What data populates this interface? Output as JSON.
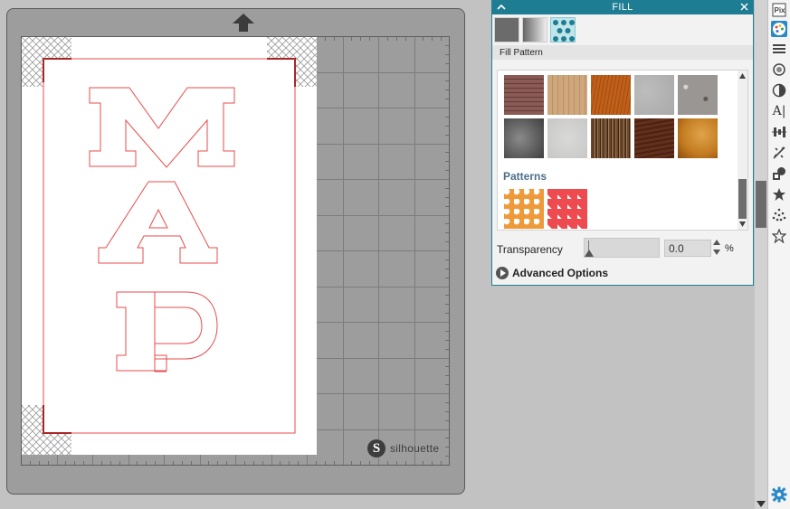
{
  "mat": {
    "brand": "silhouette"
  },
  "design": {
    "text": "MAP"
  },
  "fill_panel": {
    "title": "FILL",
    "fill_types": [
      {
        "name": "solid",
        "icon": "solid-fill-icon"
      },
      {
        "name": "gradient",
        "icon": "gradient-fill-icon"
      },
      {
        "name": "pattern",
        "icon": "pattern-fill-icon",
        "selected": true
      }
    ],
    "section_label": "Fill Pattern",
    "textures": [
      {
        "name": "brick",
        "color": "#8a5a55"
      },
      {
        "name": "light-wood",
        "color": "#cfa77d"
      },
      {
        "name": "orange-wood",
        "color": "#c0601a"
      },
      {
        "name": "concrete",
        "color": "#a9a9a9"
      },
      {
        "name": "granite",
        "color": "#9a9693"
      },
      {
        "name": "dark-stone",
        "color": "#606060"
      },
      {
        "name": "light-concrete",
        "color": "#c7c7c5"
      },
      {
        "name": "striped-wood",
        "color": "#6d4a2e"
      },
      {
        "name": "dark-wood",
        "color": "#62301c"
      },
      {
        "name": "amber-marble",
        "color": "#c27a1f"
      }
    ],
    "patterns_heading": "Patterns",
    "patterns": [
      {
        "name": "orange-floral",
        "color": "#ee9a3a"
      },
      {
        "name": "red-cubes",
        "color": "#ee4b50"
      }
    ],
    "transparency": {
      "label": "Transparency",
      "value": "0.0",
      "unit": "%",
      "level": 0
    },
    "advanced": {
      "label": "Advanced Options"
    }
  },
  "toolbar": {
    "tools": [
      {
        "name": "pixscan-icon"
      },
      {
        "name": "fill-color-icon",
        "active": true
      },
      {
        "name": "line-style-icon"
      },
      {
        "name": "line-color-icon"
      },
      {
        "name": "image-effects-icon"
      },
      {
        "name": "text-style-icon",
        "glyph": "A|"
      },
      {
        "name": "align-icon"
      },
      {
        "name": "trace-icon"
      },
      {
        "name": "replicate-icon"
      },
      {
        "name": "offset-star-icon"
      },
      {
        "name": "rhinestone-icon"
      },
      {
        "name": "favorite-star-icon"
      }
    ],
    "settings": {
      "name": "gear-icon"
    }
  }
}
